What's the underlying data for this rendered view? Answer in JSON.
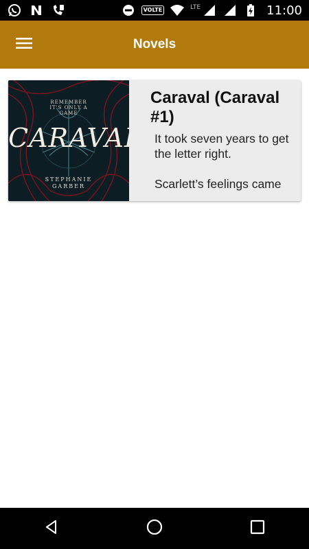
{
  "status_bar": {
    "time": "11:00",
    "volte": "VOLTE",
    "lte": "LTE",
    "left_icons": [
      "whatsapp-icon",
      "n-notification-icon",
      "phone-sync-icon"
    ],
    "right_icons": [
      "do-not-disturb-icon",
      "wifi-icon",
      "signal-icon",
      "battery-charging-icon"
    ]
  },
  "app_bar": {
    "title": "Novels",
    "menu_icon": "hamburger-menu-icon",
    "background_color": "#b27a0c"
  },
  "novels": [
    {
      "title": "Caraval (Caraval #1)",
      "excerpt": "It took seven years to get the letter right.\n\nScarlett’s feelings came",
      "cover": {
        "tagline": "REMEMBER\nIT'S ONLY A\nGAME",
        "title": "CARAVAL",
        "author": "STEPHANIE\nGARBER"
      }
    }
  ],
  "nav_bar": {
    "icons": [
      "back-icon",
      "home-icon",
      "recents-icon"
    ]
  }
}
